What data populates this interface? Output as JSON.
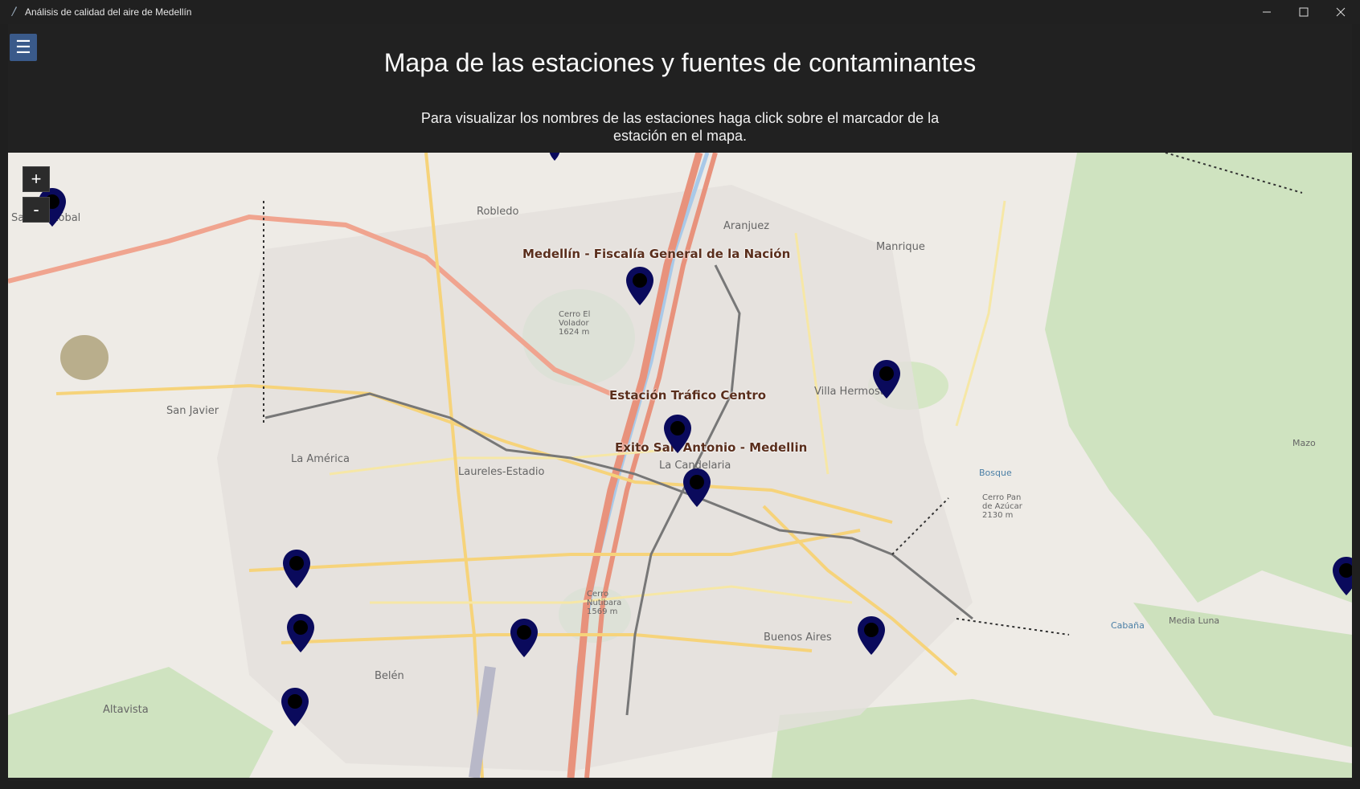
{
  "window": {
    "title": "Análisis de calidad del aire de Medellín"
  },
  "menu": {
    "icon": "hamburger-icon"
  },
  "header": {
    "title": "Mapa de las estaciones y fuentes de contaminantes",
    "subtitle": "Para visualizar los nombres de las estaciones haga click sobre el marcador de la estación en el mapa."
  },
  "map": {
    "zoom_in": "+",
    "zoom_out": "-",
    "marker_color": "#0a0a5c",
    "station_labels": [
      "Medellín - Fiscalía General de la Nación",
      "Estación Tráfico Centro",
      "Exito San Antonio - Medellin"
    ],
    "places": [
      "San Cristóbal",
      "Robledo",
      "Aranjuez",
      "Manrique",
      "San Javier",
      "La América",
      "Laureles-Estadio",
      "La Candelaria",
      "Villa Hermosa",
      "Buenos Aires",
      "Belén",
      "Altavista",
      "Cerro El Volador 1624 m",
      "Cerro Nutibara 1569 m",
      "Mazo",
      "Media Luna",
      "Bosque",
      "Cabaña",
      "Cerro Pan de Azúcar 2130 m"
    ]
  }
}
